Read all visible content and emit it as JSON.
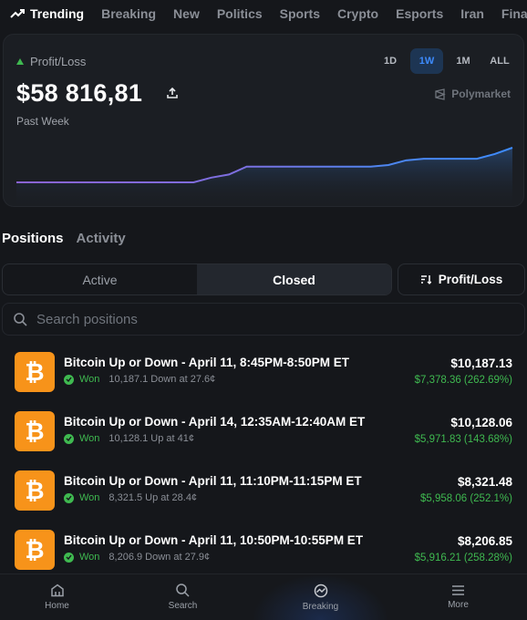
{
  "topnav": {
    "items": [
      {
        "label": "Trending",
        "icon": "trending-icon"
      },
      {
        "label": "Breaking"
      },
      {
        "label": "New"
      },
      {
        "label": "Politics"
      },
      {
        "label": "Sports"
      },
      {
        "label": "Crypto"
      },
      {
        "label": "Esports"
      },
      {
        "label": "Iran"
      },
      {
        "label": "Finance"
      }
    ]
  },
  "summary": {
    "label": "Profit/Loss",
    "amount": "$58 816,81",
    "period": "Past Week",
    "brand": "Polymarket",
    "ranges": [
      "1D",
      "1W",
      "1M",
      "ALL"
    ],
    "active_range": "1W"
  },
  "chart_data": {
    "type": "line",
    "series": [
      {
        "values": [
          0,
          0,
          0,
          0,
          0,
          0,
          0,
          0,
          0,
          0,
          0,
          0.3,
          0.5,
          1.0,
          1.0,
          1.0,
          1.0,
          1.0,
          1.0,
          1.0,
          1.0,
          1.1,
          1.4,
          1.5,
          1.5,
          1.5,
          1.5,
          1.8,
          2.2
        ]
      }
    ],
    "colors": {
      "start": "#8a63d2",
      "end": "#3d8bfd"
    }
  },
  "tabs": [
    "Positions",
    "Activity"
  ],
  "filters": {
    "segments": [
      "Active",
      "Closed"
    ],
    "active_segment": "Closed",
    "sort_label": "Profit/Loss"
  },
  "search": {
    "placeholder": "Search positions",
    "value": ""
  },
  "positions": [
    {
      "title": "Bitcoin Up or Down - April 11, 8:45PM-8:50PM ET",
      "status": "Won",
      "detail": "10,187.1 Down at 27.6¢",
      "value": "$10,187.13",
      "pnl": "$7,378.36 (262.69%)"
    },
    {
      "title": "Bitcoin Up or Down - April 14, 12:35AM-12:40AM ET",
      "status": "Won",
      "detail": "10,128.1 Up at 41¢",
      "value": "$10,128.06",
      "pnl": "$5,971.83 (143.68%)"
    },
    {
      "title": "Bitcoin Up or Down - April 11, 11:10PM-11:15PM ET",
      "status": "Won",
      "detail": "8,321.5 Up at 28.4¢",
      "value": "$8,321.48",
      "pnl": "$5,958.06 (252.1%)"
    },
    {
      "title": "Bitcoin Up or Down - April 11, 10:50PM-10:55PM ET",
      "status": "Won",
      "detail": "8,206.9 Down at 27.9¢",
      "value": "$8,206.85",
      "pnl": "$5,916.21 (258.28%)"
    }
  ],
  "bottomnav": [
    {
      "label": "Home",
      "icon": "home-icon"
    },
    {
      "label": "Search",
      "icon": "search-icon"
    },
    {
      "label": "Breaking",
      "icon": "breaking-icon"
    },
    {
      "label": "More",
      "icon": "menu-icon"
    }
  ],
  "colors": {
    "accent": "#3d8bfd",
    "positive": "#3fb950",
    "bitcoin": "#f7931a"
  }
}
